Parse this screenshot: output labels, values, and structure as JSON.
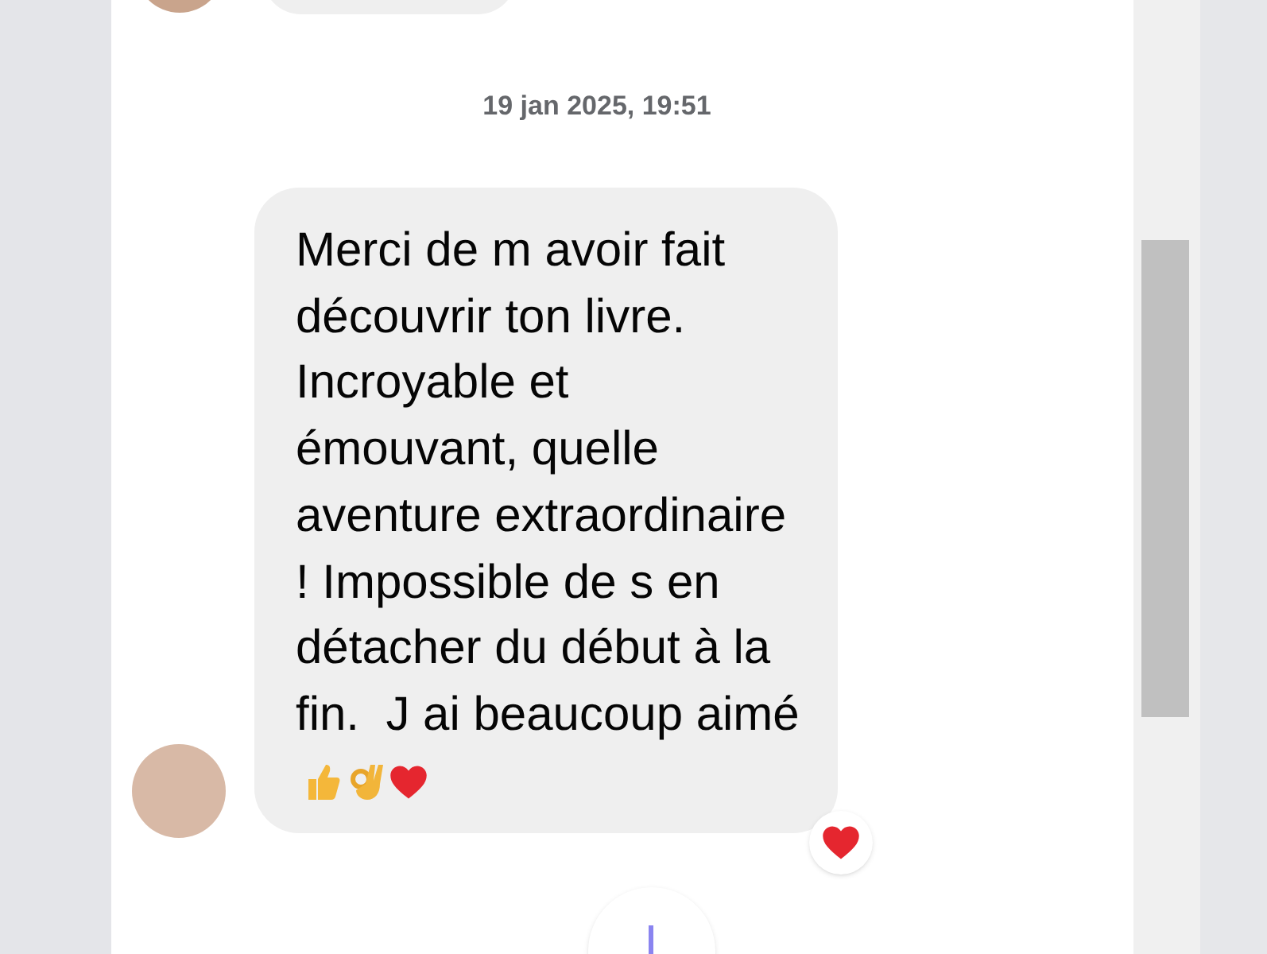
{
  "date_separator": "19 jan 2025, 19:51",
  "message": {
    "text": "Merci de m avoir fait découvrir ton livre. Incroyable et émouvant, quelle aventure extraordinaire ! Impossible de s en détacher du début à la fin.  J ai beaucoup aimé",
    "reactions": [
      {
        "kind": "heart"
      }
    ]
  }
}
